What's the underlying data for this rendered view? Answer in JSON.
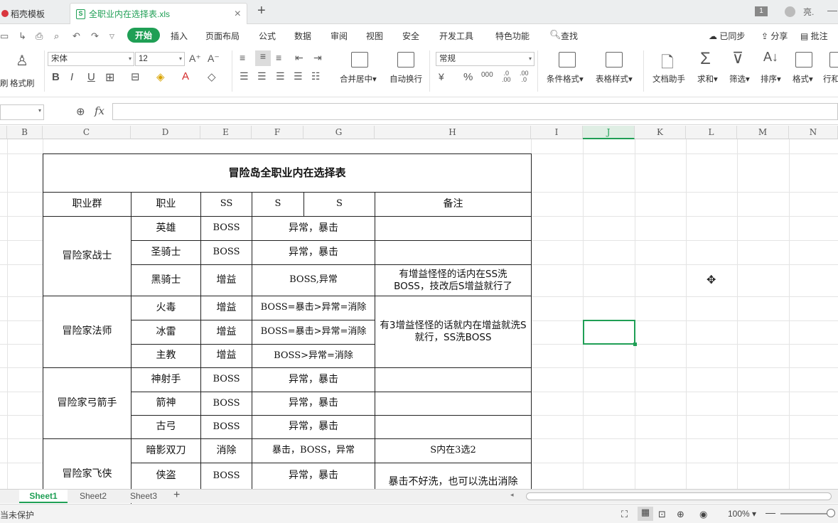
{
  "titlebar": {
    "tab1_label": "稻壳模板",
    "tab2_label": "全职业内在选择表.xls",
    "new_tab": "+",
    "page_badge": "1",
    "user": "亮."
  },
  "menu": {
    "items": [
      "开始",
      "插入",
      "页面布局",
      "公式",
      "数据",
      "审阅",
      "视图",
      "安全",
      "开发工具",
      "特色功能",
      "查找"
    ],
    "right": [
      "已同步",
      "分享",
      "批注"
    ]
  },
  "ribbon": {
    "format_painter": "格式刷",
    "font_name": "宋体",
    "font_size": "12",
    "merge_center": "合并居中",
    "wrap_text": "自动换行",
    "number_format": "常规",
    "cond_format": "条件格式",
    "table_style": "表格样式",
    "doc_helper": "文档助手",
    "sum": "求和",
    "filter": "筛选",
    "sort": "排序",
    "format": "格式",
    "rowcol": "行和"
  },
  "formula": {
    "fx_label": "fx"
  },
  "columns": [
    "B",
    "C",
    "D",
    "E",
    "F",
    "G",
    "H",
    "I",
    "J",
    "K",
    "L",
    "M",
    "N"
  ],
  "selected_column": "J",
  "table": {
    "title": "冒险岛全职业内在选择表",
    "headers": {
      "group": "职业群",
      "job": "职业",
      "ss": "SS",
      "s1": "S",
      "s2": "S",
      "note": "备注"
    },
    "warrior": {
      "group": "冒险家战士",
      "rows": [
        {
          "job": "英雄",
          "ss": "BOSS",
          "s": "异常，暴击"
        },
        {
          "job": "圣骑士",
          "ss": "BOSS",
          "s": "异常，暴击"
        },
        {
          "job": "黑骑士",
          "ss": "增益",
          "s": "BOSS,异常",
          "note": "有增益怪怪的话内在SS洗BOSS，技改后S增益就行了"
        }
      ]
    },
    "mage": {
      "group": "冒险家法师",
      "rows": [
        {
          "job": "火毒",
          "ss": "增益",
          "s": "BOSS=暴击>异常=消除"
        },
        {
          "job": "冰雷",
          "ss": "增益",
          "s": "BOSS=暴击>异常=消除"
        },
        {
          "job": "主教",
          "ss": "增益",
          "s": "BOSS>异常=消除"
        }
      ],
      "note": "有3增益怪怪的话就内在增益就洗S就行，SS洗BOSS"
    },
    "archer": {
      "group": "冒险家弓箭手",
      "rows": [
        {
          "job": "神射手",
          "ss": "BOSS",
          "s": "异常，暴击"
        },
        {
          "job": "箭神",
          "ss": "BOSS",
          "s": "异常，暴击"
        },
        {
          "job": "古弓",
          "ss": "BOSS",
          "s": "异常，暴击"
        }
      ]
    },
    "thief": {
      "group": "冒险家飞侠",
      "rows": [
        {
          "job": "暗影双刀",
          "ss": "消除",
          "s": "暴击，BOSS，异常",
          "note": "S内在3选2"
        },
        {
          "job": "侠盗",
          "ss": "BOSS",
          "s": "异常，暴击",
          "note": "暴击不好洗，也可以洗出消除"
        }
      ]
    }
  },
  "sheets": [
    "Sheet1",
    "Sheet2",
    "Sheet3"
  ],
  "status": {
    "protect": "当未保护",
    "zoom": "100%"
  }
}
